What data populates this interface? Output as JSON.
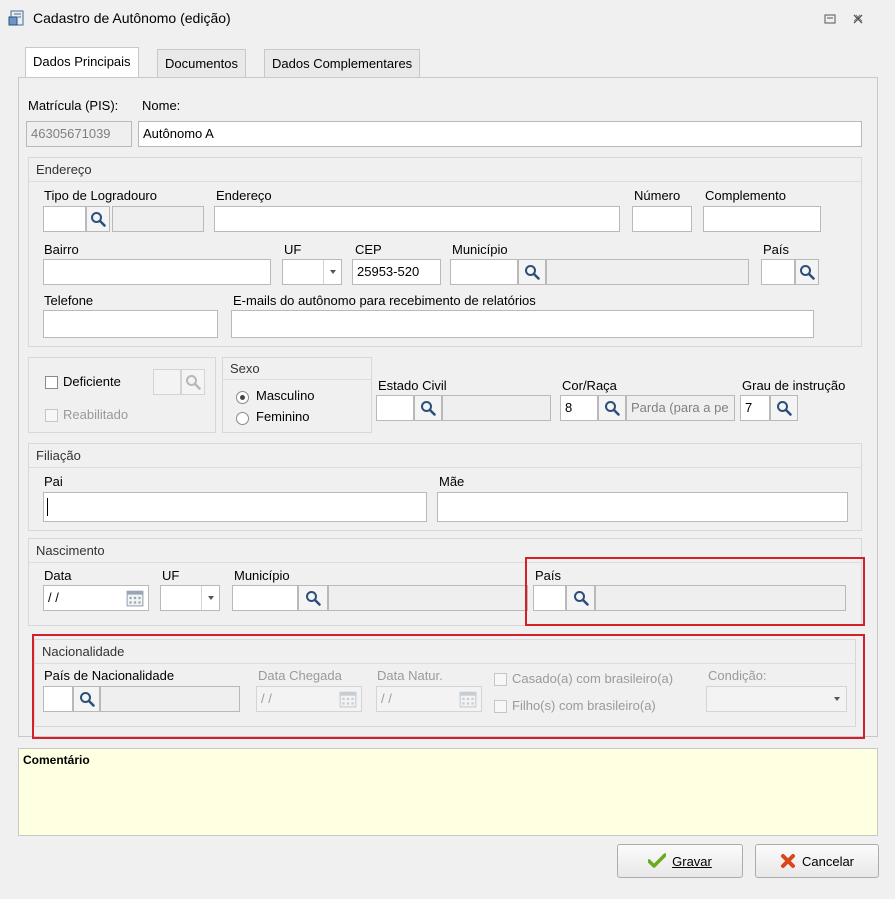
{
  "window": {
    "title": "Cadastro de Autônomo (edição)"
  },
  "tabs": [
    {
      "label": "Dados Principais",
      "active": true
    },
    {
      "label": "Documentos",
      "active": false
    },
    {
      "label": "Dados Complementares",
      "active": false
    }
  ],
  "main": {
    "matricula_label": "Matrícula (PIS):",
    "matricula_value": "46305671039",
    "nome_label": "Nome:",
    "nome_value": "Autônomo A"
  },
  "endereco": {
    "title": "Endereço",
    "tipo_logradouro_label": "Tipo de Logradouro",
    "endereco_label": "Endereço",
    "numero_label": "Número",
    "complemento_label": "Complemento",
    "bairro_label": "Bairro",
    "uf_label": "UF",
    "cep_label": "CEP",
    "cep_value": "25953-520",
    "municipio_label": "Município",
    "pais_label": "País",
    "telefone_label": "Telefone",
    "emails_label": "E-mails do autônomo para recebimento de relatórios"
  },
  "deficiente": {
    "deficiente_label": "Deficiente",
    "reabilitado_label": "Reabilitado"
  },
  "sexo": {
    "title": "Sexo",
    "masculino_label": "Masculino",
    "feminino_label": "Feminino",
    "selected": "Masculino"
  },
  "estado_civil_label": "Estado Civil",
  "cor_raca": {
    "label": "Cor/Raça",
    "code": "8",
    "desc": "Parda (para a pe"
  },
  "grau_instrucao": {
    "label": "Grau de instrução",
    "code": "7"
  },
  "filiacao": {
    "title": "Filiação",
    "pai_label": "Pai",
    "mae_label": "Mãe"
  },
  "nascimento": {
    "title": "Nascimento",
    "data_label": "Data",
    "data_value": " / /",
    "uf_label": "UF",
    "municipio_label": "Município",
    "pais_label": "País"
  },
  "nacionalidade": {
    "title": "Nacionalidade",
    "pais_label": "País de Nacionalidade",
    "data_chegada_label": "Data Chegada",
    "data_chegada_value": " / /",
    "data_natur_label": "Data Natur.",
    "data_natur_value": " / /",
    "casado_label": "Casado(a) com brasileiro(a)",
    "filhos_label": "Filho(s) com brasileiro(a)",
    "condicao_label": "Condição:"
  },
  "comentario": {
    "label": "Comentário"
  },
  "buttons": {
    "gravar": "Gravar",
    "cancelar": "Cancelar"
  },
  "colors": {
    "highlight": "#d4202b",
    "comment_bg": "#ffffe1"
  }
}
